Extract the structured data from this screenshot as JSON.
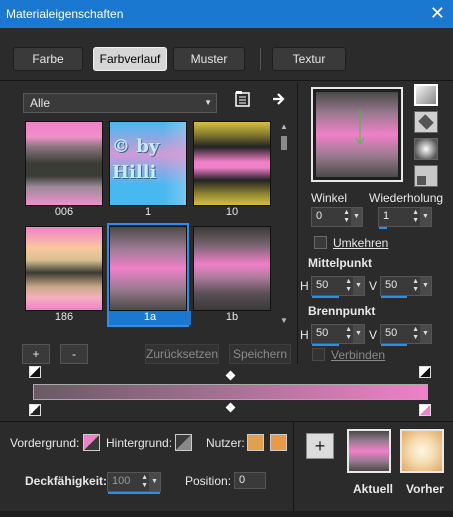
{
  "window": {
    "title": "Materialeigenschaften",
    "close_glyph": "✕"
  },
  "tabs": [
    {
      "label": "Farbe",
      "active": false
    },
    {
      "label": "Farbverlauf",
      "active": true
    },
    {
      "label": "Muster",
      "active": false
    },
    {
      "label": "Textur",
      "active": false
    }
  ],
  "library": {
    "selected": "Alle",
    "items": [
      {
        "label": "006",
        "selected": false
      },
      {
        "label": "1",
        "selected": false
      },
      {
        "label": "10",
        "selected": false
      },
      {
        "label": "186",
        "selected": false
      },
      {
        "label": "1a",
        "selected": true
      },
      {
        "label": "1b",
        "selected": false
      }
    ],
    "watermark_text": "© by Hilli"
  },
  "buttons": {
    "add": "+",
    "remove": "-",
    "reset": "Zurücksetzen",
    "save": "Speichern"
  },
  "style_options": [
    "linear",
    "rectangular",
    "radial",
    "sunburst"
  ],
  "angle": {
    "label": "Winkel",
    "value": "0"
  },
  "repeat": {
    "label": "Wiederholung",
    "value": "1"
  },
  "invert": {
    "label": "Umkehren",
    "checked": false
  },
  "center": {
    "label": "Mittelpunkt",
    "h_label": "H",
    "h_value": "50",
    "v_label": "V",
    "v_value": "50"
  },
  "focal": {
    "label": "Brennpunkt",
    "h_label": "H",
    "h_value": "50",
    "v_label": "V",
    "v_value": "50"
  },
  "link": {
    "label": "Verbinden",
    "checked": false
  },
  "colors": {
    "foreground_label": "Vordergrund:",
    "background_label": "Hintergrund:",
    "user_label": "Nutzer:",
    "user_swatch_1": "#e0a050",
    "user_swatch_2": "#e89a4a",
    "pink": "#f080c8",
    "dark": "#3a3a3a"
  },
  "opacity": {
    "label": "Deckfähigkeit:",
    "value": "100"
  },
  "position": {
    "label": "Position:",
    "value": "0"
  },
  "current": {
    "label": "Aktuell"
  },
  "previous": {
    "label": "Vorher"
  }
}
